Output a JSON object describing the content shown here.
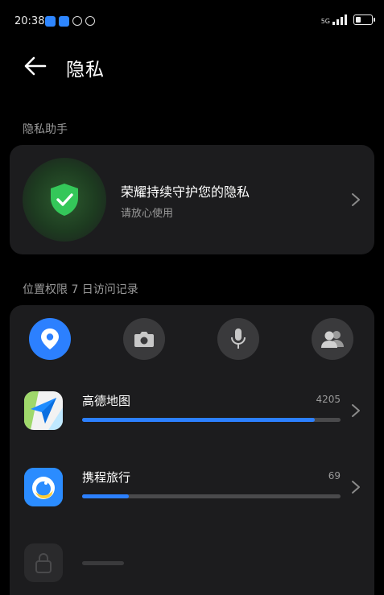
{
  "status": {
    "time": "20:38",
    "network": "5G"
  },
  "header": {
    "title": "隐私"
  },
  "assistant": {
    "section_label": "隐私助手",
    "title": "荣耀持续守护您的隐私",
    "subtitle": "请放心使用"
  },
  "location": {
    "section_label": "位置权限 7 日访问记录",
    "permissions": [
      "location-icon",
      "camera-icon",
      "microphone-icon",
      "contacts-icon"
    ],
    "apps": [
      {
        "name": "高德地图",
        "count": "4205",
        "progress": 0.9
      },
      {
        "name": "携程旅行",
        "count": "69",
        "progress": 0.18
      }
    ]
  },
  "colors": {
    "accent": "#2c80ff",
    "shield": "#34c759",
    "card": "#1c1c1e"
  }
}
